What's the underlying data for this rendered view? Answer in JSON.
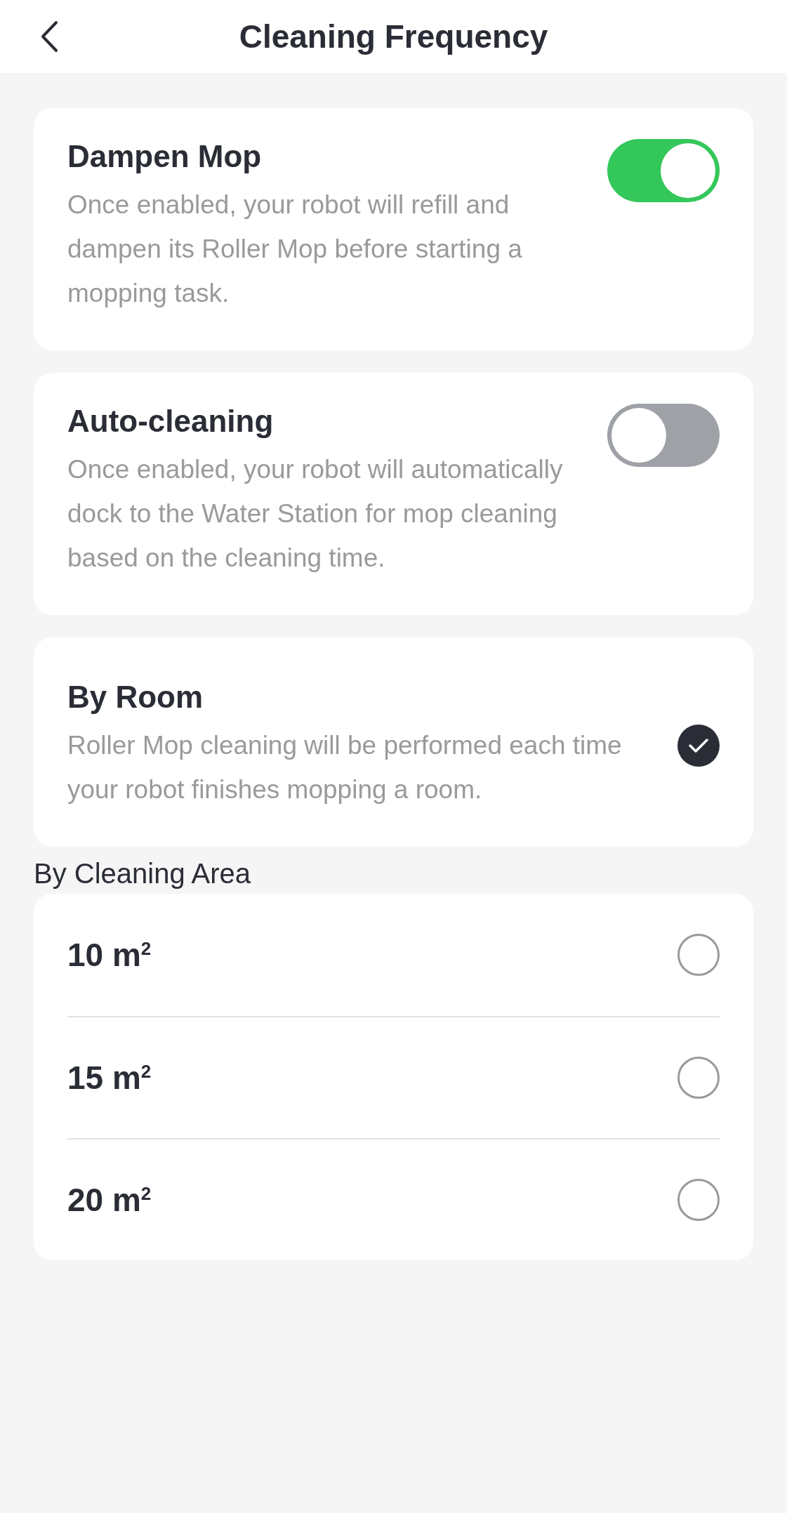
{
  "header": {
    "title": "Cleaning Frequency"
  },
  "settings": [
    {
      "kind": "toggle",
      "title": "Dampen Mop",
      "description": "Once enabled, your robot will refill and dampen its Roller Mop before starting a mopping task.",
      "on": true
    },
    {
      "kind": "toggle",
      "title": "Auto-cleaning",
      "description": "Once enabled, your robot will automatically dock to the Water Station for mop cleaning based on the cleaning time.",
      "on": false
    },
    {
      "kind": "check",
      "title": "By Room",
      "description": "Roller Mop cleaning will be performed each time your robot finishes mopping a room.",
      "selected": true
    }
  ],
  "area_section": {
    "label": "By Cleaning Area",
    "options": [
      {
        "label": "10 m$^{2}$",
        "selected": false
      },
      {
        "label": "15 m$^{2}$",
        "selected": false
      },
      {
        "label": "20 m$^{2}$",
        "selected": false
      }
    ]
  }
}
